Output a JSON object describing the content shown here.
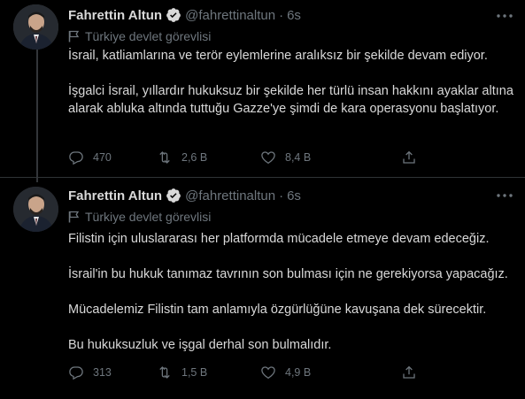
{
  "colors": {
    "background": "#000000",
    "text": "#d9d9d9",
    "muted": "#6e767d",
    "verified": "#1d9bf0",
    "divider": "#2f3336"
  },
  "tweets": [
    {
      "author": {
        "name": "Fahrettin Altun",
        "handle": "@fahrettinaltun",
        "avatar_icon": "profile-photo",
        "verified_icon": "verified-badge-icon"
      },
      "separator": "·",
      "time": "6s",
      "label": "Türkiye devlet görevlisi",
      "paragraphs": [
        "İsrail, katliamlarına ve terör eylemlerine aralıksız bir şekilde devam ediyor.",
        "İşgalci İsrail, yıllardır hukuksuz bir şekilde her türlü insan hakkını ayaklar altına alarak abluka altında tuttuğu Gazze'ye şimdi de kara operasyonu başlatıyor."
      ],
      "actions": {
        "replies": "470",
        "retweets": "2,6 B",
        "likes": "8,4 B"
      }
    },
    {
      "author": {
        "name": "Fahrettin Altun",
        "handle": "@fahrettinaltun",
        "avatar_icon": "profile-photo",
        "verified_icon": "verified-badge-icon"
      },
      "separator": "·",
      "time": "6s",
      "label": "Türkiye devlet görevlisi",
      "paragraphs": [
        "Filistin için uluslararası her platformda mücadele etmeye devam edeceğiz.",
        "İsrail'in bu hukuk tanımaz tavrının son bulması için ne gerekiyorsa yapacağız.",
        "Mücadelemiz Filistin tam anlamıyla özgürlüğüne kavuşana dek sürecektir.",
        "Bu hukuksuzluk ve işgal derhal son bulmalıdır."
      ],
      "actions": {
        "replies": "313",
        "retweets": "1,5 B",
        "likes": "4,9 B"
      }
    }
  ]
}
